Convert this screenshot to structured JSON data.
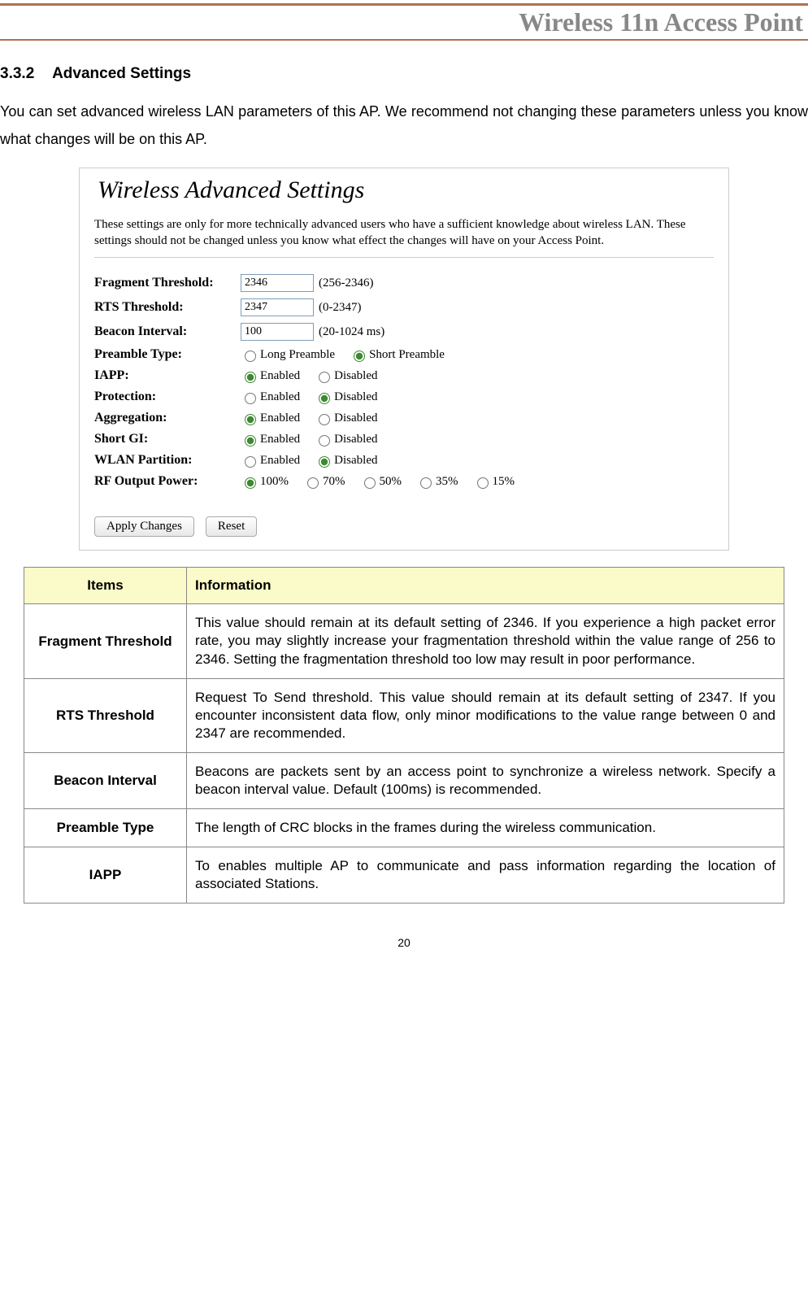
{
  "header": {
    "title": "Wireless 11n Access Point"
  },
  "section": {
    "number": "3.3.2",
    "title": "Advanced Settings",
    "intro": "You can set advanced wireless LAN parameters of this AP. We recommend not changing these parameters unless you know what changes will be on this AP."
  },
  "screenshot": {
    "title": "Wireless Advanced Settings",
    "desc": "These settings are only for more technically advanced users who have a sufficient knowledge about wireless LAN. These settings should not be changed unless you know what effect the changes will have on your Access Point.",
    "rows": [
      {
        "label": "Fragment Threshold:",
        "type": "text",
        "value": "2346",
        "range": "(256-2346)"
      },
      {
        "label": "RTS Threshold:",
        "type": "text",
        "value": "2347",
        "range": "(0-2347)"
      },
      {
        "label": "Beacon Interval:",
        "type": "text",
        "value": "100",
        "range": "(20-1024 ms)"
      },
      {
        "label": "Preamble Type:",
        "type": "radio",
        "options": [
          "Long Preamble",
          "Short Preamble"
        ],
        "selected": "Short Preamble"
      },
      {
        "label": "IAPP:",
        "type": "radio",
        "options": [
          "Enabled",
          "Disabled"
        ],
        "selected": "Enabled"
      },
      {
        "label": "Protection:",
        "type": "radio",
        "options": [
          "Enabled",
          "Disabled"
        ],
        "selected": "Disabled"
      },
      {
        "label": "Aggregation:",
        "type": "radio",
        "options": [
          "Enabled",
          "Disabled"
        ],
        "selected": "Enabled"
      },
      {
        "label": "Short GI:",
        "type": "radio",
        "options": [
          "Enabled",
          "Disabled"
        ],
        "selected": "Enabled"
      },
      {
        "label": "WLAN Partition:",
        "type": "radio",
        "options": [
          "Enabled",
          "Disabled"
        ],
        "selected": "Disabled"
      },
      {
        "label": "RF Output Power:",
        "type": "radio",
        "options": [
          "100%",
          "70%",
          "50%",
          "35%",
          "15%"
        ],
        "selected": "100%"
      }
    ],
    "buttons": {
      "apply": "Apply Changes",
      "reset": "Reset"
    }
  },
  "table": {
    "header": {
      "col1": "Items",
      "col2": "Information"
    },
    "rows": [
      {
        "item": "Fragment Threshold",
        "info": "This value should remain at its default setting of 2346. If you experience a high packet error rate, you may slightly increase your fragmentation threshold within the value range of 256 to 2346. Setting the fragmentation threshold too low may result in poor performance."
      },
      {
        "item": "RTS Threshold",
        "info": "Request To Send threshold. This value should remain at its default setting of 2347. If you encounter inconsistent data flow, only minor modifications to the value range between 0 and 2347 are recommended."
      },
      {
        "item": "Beacon Interval",
        "info": "Beacons are packets sent by an access point to synchronize a wireless network. Specify a beacon interval value. Default (100ms) is recommended."
      },
      {
        "item": "Preamble Type",
        "info": "The length of CRC blocks in the frames during the wireless communication."
      },
      {
        "item": "IAPP",
        "info": "To enables multiple AP to communicate and pass information regarding the location of associated Stations."
      }
    ]
  },
  "page_number": "20"
}
